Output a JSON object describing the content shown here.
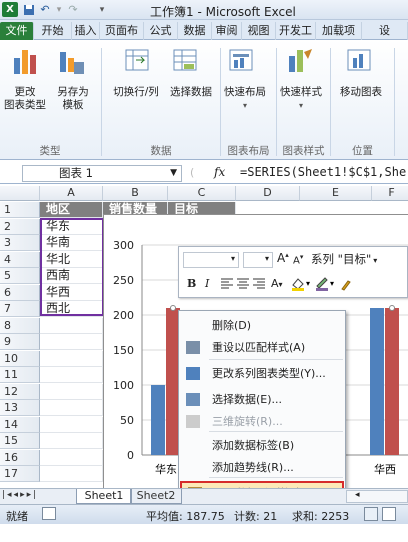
{
  "title": "工作簿1 - Microsoft Excel",
  "quick_access": {
    "save_icon": "save-icon",
    "undo": "↶",
    "redo": "↷",
    "customize": "▾"
  },
  "tabs": [
    "文件",
    "开始",
    "插入",
    "页面布",
    "公式",
    "数据",
    "审阅",
    "视图",
    "开发工",
    "加载项",
    "设"
  ],
  "ribbon": {
    "buttons": [
      "更改\n图表类型",
      "另存为\n模板",
      "切换行/列",
      "选择数据",
      "快速布局",
      "快速样式",
      "移动图表"
    ],
    "groups": [
      "类型",
      "数据",
      "图表布局",
      "图表样式",
      "位置"
    ]
  },
  "name_box": "图表 1",
  "fx": "fx",
  "formula": "=SERIES(Sheet1!$C$1,She",
  "columns": [
    "A",
    "B",
    "C",
    "D",
    "E",
    "F"
  ],
  "rows": [
    "1",
    "2",
    "3",
    "4",
    "5",
    "6",
    "7",
    "8",
    "9",
    "10",
    "11",
    "12",
    "13",
    "14",
    "15",
    "16",
    "17"
  ],
  "cells": {
    "A1": "地区",
    "B1": "销售数量",
    "C1": "目标",
    "A2": "华东",
    "A3": "华南",
    "A4": "华北",
    "A5": "西南",
    "A6": "华西",
    "A7": "西北"
  },
  "float_toolbar": {
    "series_select": "系列 \"目标\"",
    "font_grow": "A",
    "font_shrink": "A",
    "bold": "B",
    "italic": "I"
  },
  "chart": {
    "y_ticks": [
      "300",
      "250",
      "200",
      "150",
      "100",
      "50",
      "0"
    ],
    "x_labels": [
      "华东",
      "华西"
    ],
    "colors": {
      "series1": "#4f81bd",
      "series2": "#c0504d"
    }
  },
  "chart_data": {
    "type": "bar",
    "categories": [
      "华东",
      "华南",
      "华北",
      "西南",
      "华西",
      "西北"
    ],
    "ylim": [
      0,
      300
    ],
    "visible_values": {
      "华东": [
        100,
        210
      ],
      "华西": [
        210,
        210
      ]
    }
  },
  "context_menu": [
    {
      "label": "删除(D)",
      "icon": "delete-icon",
      "disabled": false
    },
    {
      "label": "重设以匹配样式(A)",
      "icon": "reset-style-icon",
      "disabled": false
    },
    {
      "label": "更改系列图表类型(Y)...",
      "icon": "chart-type-icon",
      "disabled": false
    },
    {
      "label": "选择数据(E)...",
      "icon": "select-data-icon",
      "disabled": false
    },
    {
      "label": "三维旋转(R)...",
      "icon": "rotate-3d-icon",
      "disabled": true
    },
    {
      "label": "添加数据标签(B)",
      "icon": "",
      "disabled": false
    },
    {
      "label": "添加趋势线(R)...",
      "icon": "",
      "disabled": false
    },
    {
      "label": "设置数据系列格式(F)...",
      "icon": "format-series-icon",
      "disabled": false
    }
  ],
  "sheet_tabs": [
    "Sheet1",
    "Sheet2"
  ],
  "status": {
    "ready": "就绪",
    "average": "平均值: 187.75",
    "count": "计数: 21",
    "sum": "求和: 2253"
  }
}
